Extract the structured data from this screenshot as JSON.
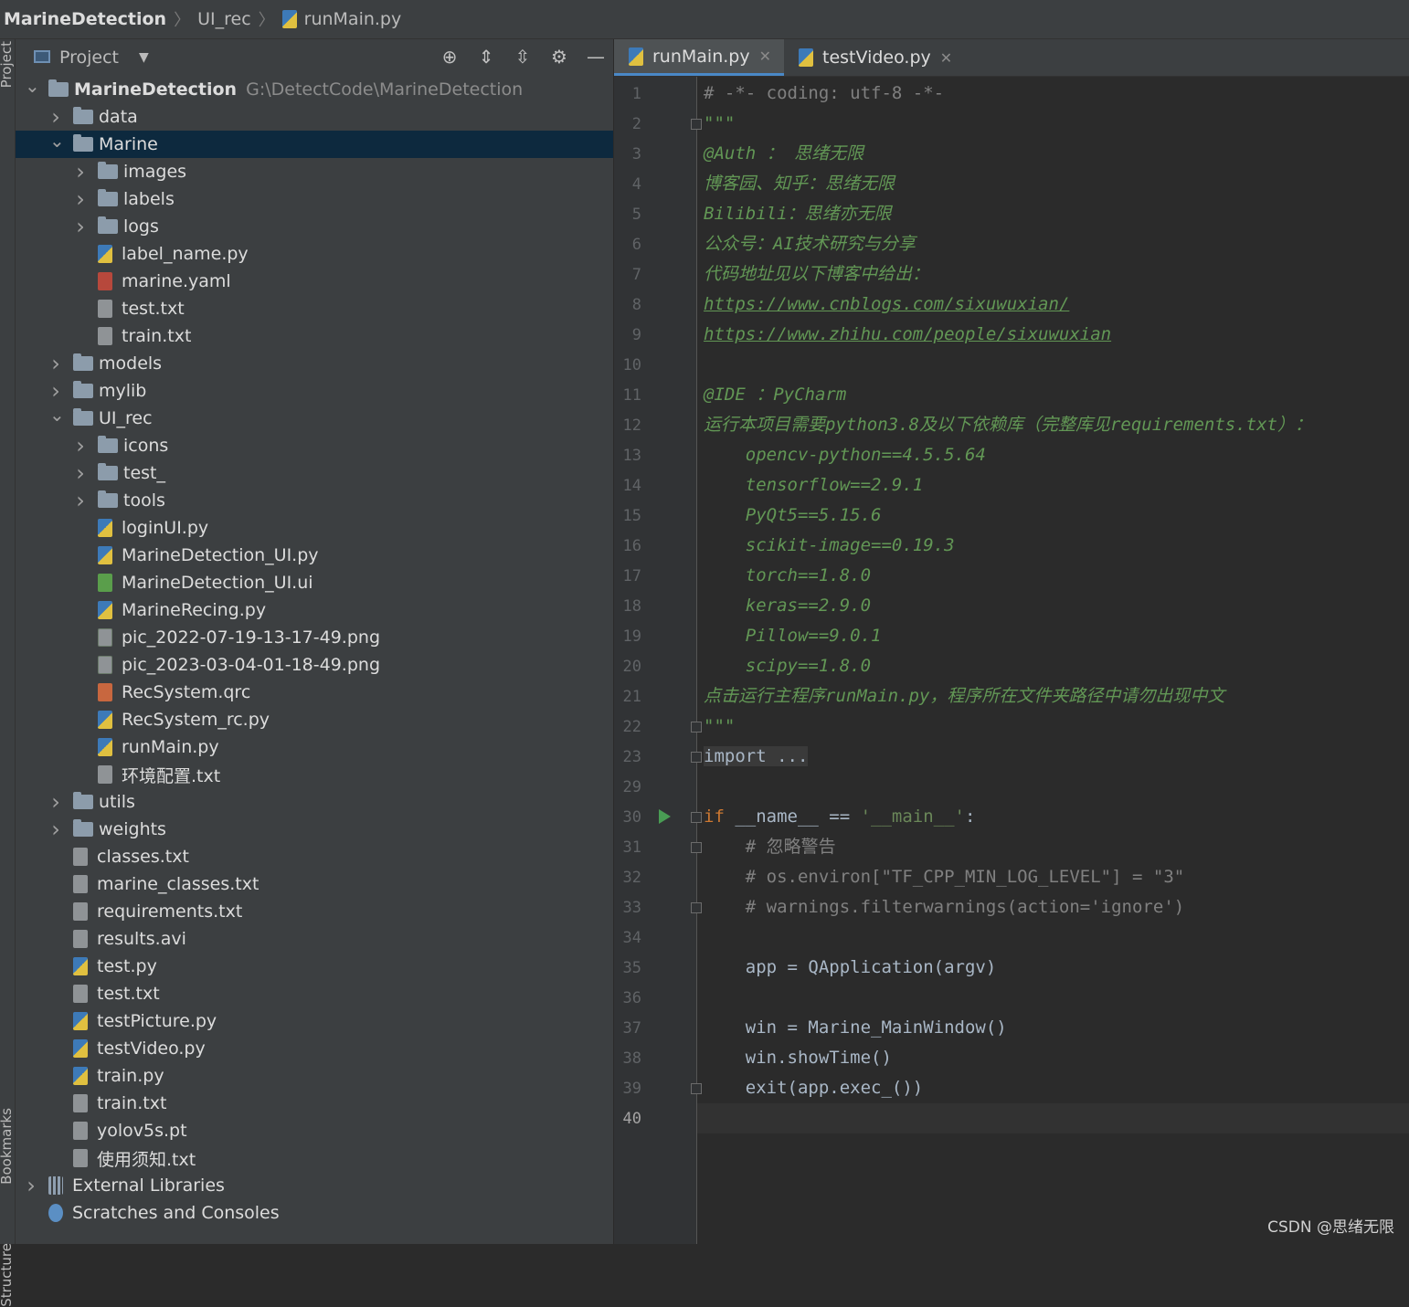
{
  "breadcrumb": [
    "MarineDetection",
    "UI_rec",
    "runMain.py"
  ],
  "side_strip": {
    "project": "Project",
    "bookmarks": "Bookmarks",
    "structure": "Structure"
  },
  "panel": {
    "title": "Project"
  },
  "tree": [
    {
      "label": "MarineDetection",
      "path": "G:\\DetectCode\\MarineDetection",
      "kind": "folder",
      "depth": 0,
      "arrow": "v",
      "bold": true
    },
    {
      "label": "data",
      "kind": "folder",
      "depth": 1,
      "arrow": ">"
    },
    {
      "label": "Marine",
      "kind": "folder",
      "depth": 1,
      "arrow": "v",
      "selected": true
    },
    {
      "label": "images",
      "kind": "folder",
      "depth": 2,
      "arrow": ">"
    },
    {
      "label": "labels",
      "kind": "folder",
      "depth": 2,
      "arrow": ">"
    },
    {
      "label": "logs",
      "kind": "folder",
      "depth": 2,
      "arrow": ">"
    },
    {
      "label": "label_name.py",
      "kind": "py",
      "depth": 2
    },
    {
      "label": "marine.yaml",
      "kind": "yaml",
      "depth": 2
    },
    {
      "label": "test.txt",
      "kind": "txt",
      "depth": 2
    },
    {
      "label": "train.txt",
      "kind": "txt",
      "depth": 2
    },
    {
      "label": "models",
      "kind": "folder",
      "depth": 1,
      "arrow": ">"
    },
    {
      "label": "mylib",
      "kind": "folder",
      "depth": 1,
      "arrow": ">"
    },
    {
      "label": "UI_rec",
      "kind": "folder",
      "depth": 1,
      "arrow": "v"
    },
    {
      "label": "icons",
      "kind": "folder",
      "depth": 2,
      "arrow": ">"
    },
    {
      "label": "test_",
      "kind": "folder",
      "depth": 2,
      "arrow": ">"
    },
    {
      "label": "tools",
      "kind": "folder",
      "depth": 2,
      "arrow": ">"
    },
    {
      "label": "loginUI.py",
      "kind": "py",
      "depth": 2
    },
    {
      "label": "MarineDetection_UI.py",
      "kind": "py",
      "depth": 2
    },
    {
      "label": "MarineDetection_UI.ui",
      "kind": "ui",
      "depth": 2
    },
    {
      "label": "MarineRecing.py",
      "kind": "py",
      "depth": 2
    },
    {
      "label": "pic_2022-07-19-13-17-49.png",
      "kind": "png",
      "depth": 2
    },
    {
      "label": "pic_2023-03-04-01-18-49.png",
      "kind": "png",
      "depth": 2
    },
    {
      "label": "RecSystem.qrc",
      "kind": "qrc",
      "depth": 2
    },
    {
      "label": "RecSystem_rc.py",
      "kind": "py",
      "depth": 2
    },
    {
      "label": "runMain.py",
      "kind": "py",
      "depth": 2
    },
    {
      "label": "环境配置.txt",
      "kind": "txt",
      "depth": 2
    },
    {
      "label": "utils",
      "kind": "folder",
      "depth": 1,
      "arrow": ">"
    },
    {
      "label": "weights",
      "kind": "folder",
      "depth": 1,
      "arrow": ">"
    },
    {
      "label": "classes.txt",
      "kind": "txt",
      "depth": 1
    },
    {
      "label": "marine_classes.txt",
      "kind": "txt",
      "depth": 1
    },
    {
      "label": "requirements.txt",
      "kind": "txt",
      "depth": 1
    },
    {
      "label": "results.avi",
      "kind": "unk",
      "depth": 1
    },
    {
      "label": "test.py",
      "kind": "py",
      "depth": 1
    },
    {
      "label": "test.txt",
      "kind": "txt",
      "depth": 1
    },
    {
      "label": "testPicture.py",
      "kind": "py",
      "depth": 1
    },
    {
      "label": "testVideo.py",
      "kind": "py",
      "depth": 1
    },
    {
      "label": "train.py",
      "kind": "py",
      "depth": 1
    },
    {
      "label": "train.txt",
      "kind": "txt",
      "depth": 1
    },
    {
      "label": "yolov5s.pt",
      "kind": "unk",
      "depth": 1
    },
    {
      "label": "使用须知.txt",
      "kind": "txt",
      "depth": 1
    },
    {
      "label": "External Libraries",
      "kind": "lib",
      "depth": 0,
      "arrow": ">"
    },
    {
      "label": "Scratches and Consoles",
      "kind": "scr",
      "depth": 0
    }
  ],
  "tabs": [
    {
      "label": "runMain.py",
      "active": true
    },
    {
      "label": "testVideo.py",
      "active": false
    }
  ],
  "code": [
    {
      "n": "1",
      "t": "# -*- coding: utf-8 -*-",
      "c": "com"
    },
    {
      "n": "2",
      "t": "\"\"\"",
      "c": "doc",
      "fold": true
    },
    {
      "n": "3",
      "t": "@Auth ： 思绪无限",
      "c": "doc"
    },
    {
      "n": "4",
      "t": "博客园、知乎：思绪无限",
      "c": "doc"
    },
    {
      "n": "5",
      "t": "Bilibili：思绪亦无限",
      "c": "doc"
    },
    {
      "n": "6",
      "t": "公众号：AI技术研究与分享",
      "c": "doc"
    },
    {
      "n": "7",
      "t": "代码地址见以下博客中给出：",
      "c": "doc"
    },
    {
      "n": "8",
      "t": "https://www.cnblogs.com/sixuwuxian/",
      "c": "link"
    },
    {
      "n": "9",
      "t": "https://www.zhihu.com/people/sixuwuxian",
      "c": "link"
    },
    {
      "n": "10",
      "t": "",
      "c": "doc"
    },
    {
      "n": "11",
      "t": "@IDE ：PyCharm",
      "c": "doc"
    },
    {
      "n": "12",
      "t": "运行本项目需要python3.8及以下依赖库（完整库见requirements.txt）：",
      "c": "doc"
    },
    {
      "n": "13",
      "t": "    opencv-python==4.5.5.64",
      "c": "doc"
    },
    {
      "n": "14",
      "t": "    tensorflow==2.9.1",
      "c": "doc"
    },
    {
      "n": "15",
      "t": "    PyQt5==5.15.6",
      "c": "doc"
    },
    {
      "n": "16",
      "t": "    scikit-image==0.19.3",
      "c": "doc"
    },
    {
      "n": "17",
      "t": "    torch==1.8.0",
      "c": "doc"
    },
    {
      "n": "18",
      "t": "    keras==2.9.0",
      "c": "doc"
    },
    {
      "n": "19",
      "t": "    Pillow==9.0.1",
      "c": "doc"
    },
    {
      "n": "20",
      "t": "    scipy==1.8.0",
      "c": "doc"
    },
    {
      "n": "21",
      "t": "点击运行主程序runMain.py，程序所在文件夹路径中请勿出现中文",
      "c": "doc"
    },
    {
      "n": "22",
      "t": "\"\"\"",
      "c": "doc",
      "fold": true
    },
    {
      "n": "23",
      "t": "import ...",
      "c": "fold",
      "fold": true
    },
    {
      "n": "29",
      "t": "",
      "c": "def"
    },
    {
      "n": "30",
      "t": "if __name__ == '__main__':",
      "c": "if",
      "run": true,
      "fold": true
    },
    {
      "n": "31",
      "t": "    # 忽略警告",
      "c": "com",
      "fold": true
    },
    {
      "n": "32",
      "t": "    # os.environ[\"TF_CPP_MIN_LOG_LEVEL\"] = \"3\"",
      "c": "com"
    },
    {
      "n": "33",
      "t": "    # warnings.filterwarnings(action='ignore')",
      "c": "com",
      "fold": true
    },
    {
      "n": "34",
      "t": "",
      "c": "def"
    },
    {
      "n": "35",
      "t": "    app = QApplication(argv)",
      "c": "def"
    },
    {
      "n": "36",
      "t": "",
      "c": "def"
    },
    {
      "n": "37",
      "t": "    win = Marine_MainWindow()",
      "c": "def"
    },
    {
      "n": "38",
      "t": "    win.showTime()",
      "c": "def"
    },
    {
      "n": "39",
      "t": "    exit(app.exec_())",
      "c": "def",
      "fold": true
    },
    {
      "n": "40",
      "t": "",
      "c": "def",
      "current": true
    }
  ],
  "if_parts": {
    "kw": "if",
    "mid": " __name__ == ",
    "str": "'__main__'",
    "end": ":"
  },
  "watermark": "CSDN @思绪无限",
  "colors": {
    "selection": "#0d293e",
    "doc": "#629755",
    "keyword": "#cc7832",
    "string": "#6a8759",
    "comment": "#808080"
  }
}
